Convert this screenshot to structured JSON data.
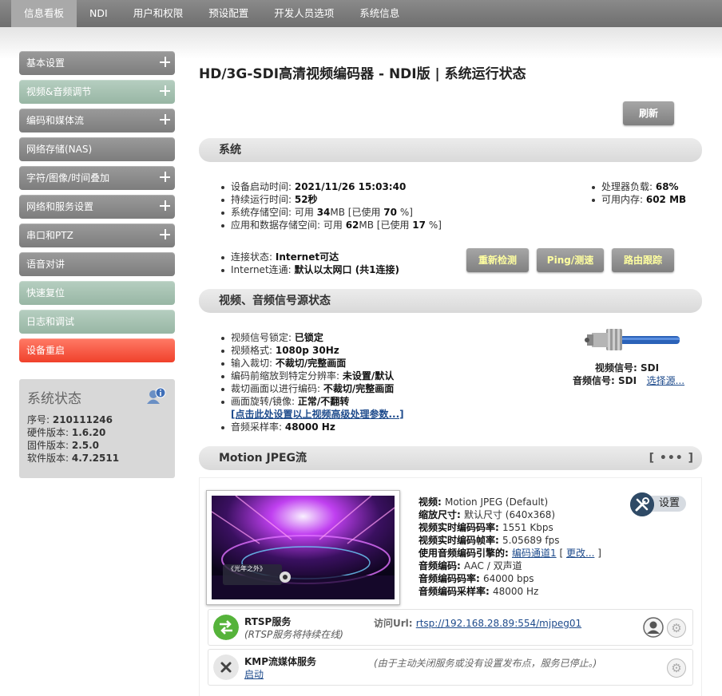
{
  "topnav": {
    "tabs": [
      {
        "label": "信息看板"
      },
      {
        "label": "NDI"
      },
      {
        "label": "用户和权限"
      },
      {
        "label": "预设配置"
      },
      {
        "label": "开发人员选项"
      },
      {
        "label": "系统信息"
      }
    ]
  },
  "sidebar": {
    "items": [
      {
        "label": "基本设置",
        "expandable": true,
        "color": "#8c8c8c"
      },
      {
        "label": "视频&音频调节",
        "expandable": true,
        "color": "#a7c3b2"
      },
      {
        "label": "编码和媒体流",
        "expandable": true,
        "color": "#8c8c8c"
      },
      {
        "label": "网络存储(NAS)",
        "expandable": false,
        "color": "#8c8c8c"
      },
      {
        "label": "字符/图像/时间叠加",
        "expandable": true,
        "color": "#8c8c8c"
      },
      {
        "label": "网络和服务设置",
        "expandable": true,
        "color": "#8c8c8c"
      },
      {
        "label": "串口和PTZ",
        "expandable": true,
        "color": "#8c8c8c"
      },
      {
        "label": "语音对讲",
        "expandable": false,
        "color": "#8c8c8c"
      },
      {
        "label": "快速复位",
        "expandable": false,
        "color": "#a7c3b2"
      },
      {
        "label": "日志和调试",
        "expandable": false,
        "color": "#a7c3b2"
      },
      {
        "label": "设备重启",
        "expandable": false,
        "color": "#f2533c"
      }
    ]
  },
  "status_box": {
    "title": "系统状态",
    "serial_label": "序号: ",
    "serial": "210111246",
    "hw_label": "硬件版本: ",
    "hw": "1.6.20",
    "fw_label": "固件版本: ",
    "fw": "2.5.0",
    "sw_label": "软件版本: ",
    "sw": "4.7.2511"
  },
  "main": {
    "title": "HD/3G-SDI高清视频编码器 - NDI版 | 系统运行状态",
    "refresh_label": "刷新"
  },
  "system": {
    "heading": "系统",
    "boot_label": "设备启动时间: ",
    "boot": "2021/11/26 15:03:40",
    "uptime_label": "持续运行时间: ",
    "uptime": "52秒",
    "storage_pre": "系统存储空间: 可用 ",
    "storage_avail": "34",
    "storage_mid": "MB [已使用 ",
    "storage_used": "70",
    "storage_post": " %]",
    "appstore_pre": "应用和数据存储空间: 可用 ",
    "appstore_avail": "62",
    "appstore_mid": "MB [已使用 ",
    "appstore_used": "17",
    "appstore_post": " %]",
    "cpu_label": "处理器负载: ",
    "cpu": "68%",
    "mem_label": "可用内存: ",
    "mem": "602 MB",
    "conn_label": "连接状态: ",
    "conn": "Internet可达",
    "route_label": "Internet连通: ",
    "route": "默认以太网口 (共1连接)",
    "btn_recheck": "重新检测",
    "btn_ping": "Ping/测速",
    "btn_trace": "路由跟踪"
  },
  "signal": {
    "heading": "视频、音频信号源状态",
    "lock_label": "视频信号锁定: ",
    "lock": "已锁定",
    "format_label": "视频格式: ",
    "format": "1080p 30Hz",
    "crop_label": "输入裁切: ",
    "crop": "不裁切/完整画面",
    "scale_label": "编码前缩放到特定分辨率: ",
    "scale": "未设置/默认",
    "cropenc_label": "裁切画面以进行编码: ",
    "cropenc": "不裁切/完整画面",
    "rotate_label": "画面旋转/镜像: ",
    "rotate": "正常/不翻转",
    "adv_link": "[点击此处设置以上视频高级处理参数...]",
    "samplerate_label": "音频采样率: ",
    "samplerate": "48000 Hz",
    "video_sig_label": "视频信号: ",
    "video_sig": "SDI",
    "audio_sig_label": "音频信号: ",
    "audio_sig": "SDI",
    "select_source": "选择源..."
  },
  "mjpeg": {
    "heading": "Motion JPEG流",
    "dots": "[ ••• ]",
    "video_label": "视频: ",
    "video": "Motion JPEG (Default)",
    "size_label": "缩放尺寸: ",
    "size": "默认尺寸 (640x368)",
    "bitrate_label": "视频实时编码码率: ",
    "bitrate": "1551 Kbps",
    "fps_label": "视频实时编码帧率: ",
    "fps": "5.05689 fps",
    "engine_label": "使用音频编码引擎的: ",
    "engine_link": "编码通道1",
    "engine_mid": " [ ",
    "engine_change": "更改...",
    "engine_end": " ]",
    "aenc_label": "音频编码: ",
    "aenc": "AAC / 双声道",
    "abitrate_label": "音频编码码率: ",
    "abitrate": "64000 bps",
    "asample_label": "音频编码采样率: ",
    "asample": "48000 Hz",
    "settings_label": "设置",
    "thumb_caption": "《光年之外》"
  },
  "services": {
    "rtsp": {
      "name": "RTSP服务",
      "sub": "(RTSP服务将持续在线)",
      "url_label": "访问Url: ",
      "url": "rtsp://192.168.28.89:554/mjpeg01"
    },
    "kmp": {
      "name": "KMP流媒体服务",
      "start": "启动",
      "note": "(由于主动关闭服务或没有设置发布点，服务已停止。)"
    }
  }
}
